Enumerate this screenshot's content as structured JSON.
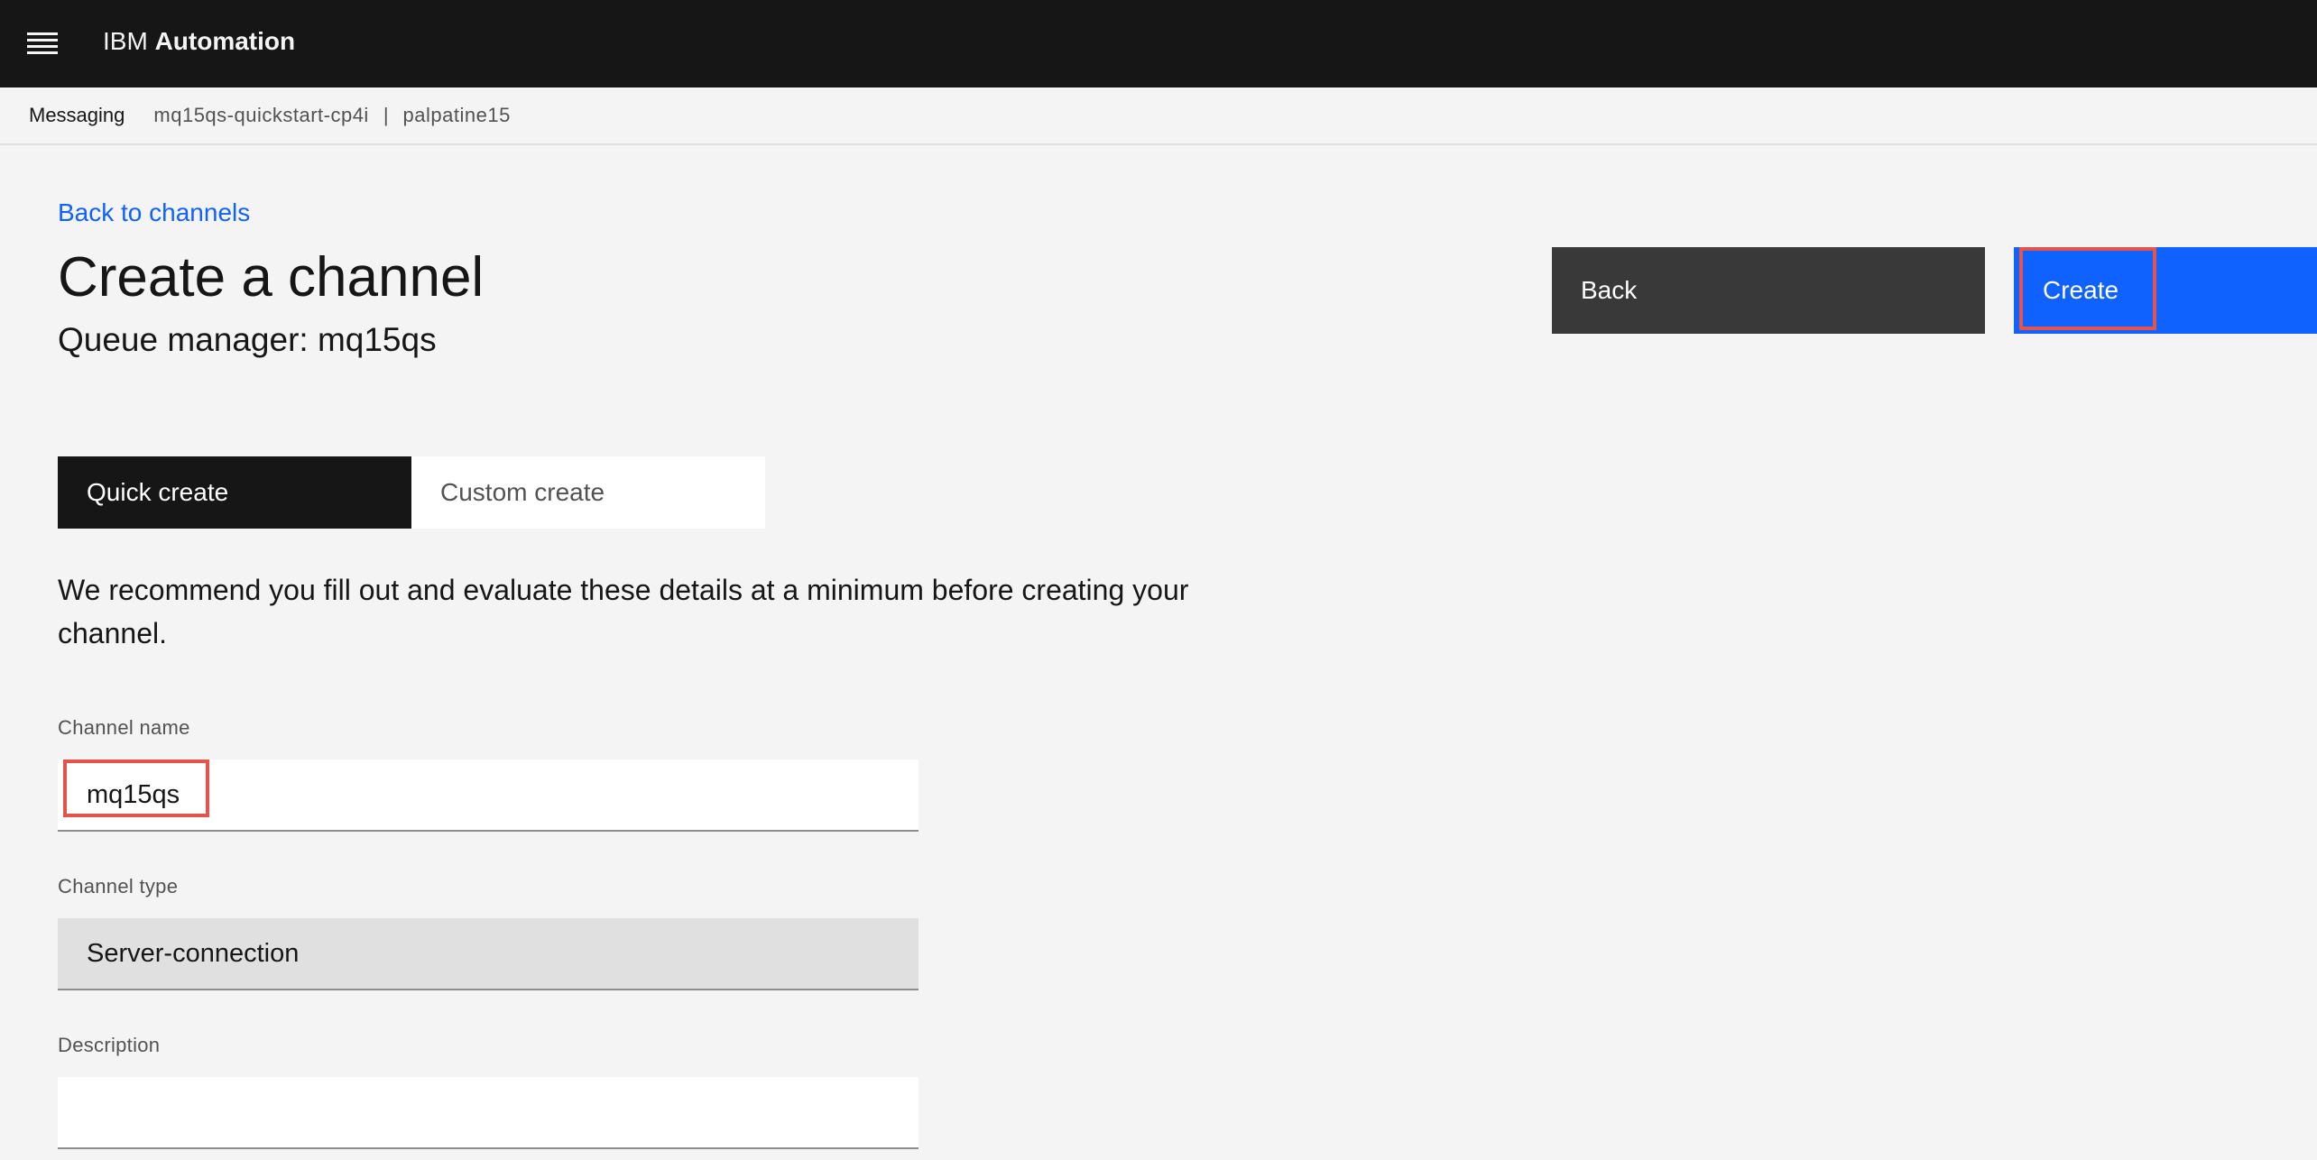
{
  "header": {
    "brand_prefix": "IBM",
    "brand_name": "Automation"
  },
  "breadcrumb": {
    "section": "Messaging",
    "instance": "mq15qs-quickstart-cp4i",
    "separator": "|",
    "queue_manager": "palpatine15"
  },
  "page": {
    "back_link": "Back to channels",
    "title": "Create a channel",
    "subtitle": "Queue manager: mq15qs"
  },
  "actions": {
    "back_label": "Back",
    "create_label": "Create"
  },
  "tabs": [
    {
      "label": "Quick create",
      "selected": true
    },
    {
      "label": "Custom create",
      "selected": false
    }
  ],
  "intro_text": "We recommend you fill out and evaluate these details at a minimum before creating your channel.",
  "form": {
    "channel_name": {
      "label": "Channel name",
      "value": "mq15qs"
    },
    "channel_type": {
      "label": "Channel type",
      "value": "Server-connection"
    },
    "description": {
      "label": "Description",
      "value": ""
    }
  },
  "colors": {
    "header_bg": "#161616",
    "primary": "#0f62fe",
    "secondary": "#393939",
    "highlight": "#e5544b"
  }
}
